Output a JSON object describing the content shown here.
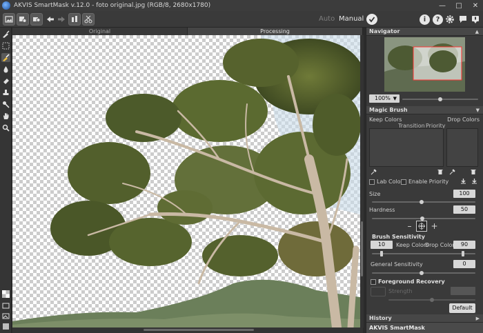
{
  "window": {
    "title": "AKVIS SmartMask v.12.0 - foto original.jpg (RGB/8, 2680x1780)"
  },
  "toolbar": {
    "mode_auto": "Auto",
    "mode_manual": "Manual"
  },
  "tabs": [
    {
      "label": "Original"
    },
    {
      "label": "Processing"
    }
  ],
  "navigator": {
    "title": "Navigator",
    "zoom": "100%"
  },
  "magic_brush": {
    "title": "Magic Brush",
    "keep_colors": "Keep Colors",
    "drop_colors": "Drop Colors",
    "transition": "Transition",
    "priority": "Priority",
    "lab_colors": "Lab Colors",
    "enable_priority": "Enable Priority",
    "size_label": "Size",
    "size_value": "100",
    "hardness_label": "Hardness",
    "hardness_value": "50",
    "brush_sensitivity": "Brush Sensitivity",
    "keep_value": "10",
    "keep_label": "Keep Colors",
    "drop_label": "Drop Colors",
    "drop_value": "90",
    "general_sensitivity": "General Sensitivity",
    "general_value": "0",
    "foreground_recovery": "Foreground Recovery",
    "strength_label": "Strength",
    "default_button": "Default"
  },
  "history": {
    "title": "History",
    "footer": "AKVIS SmartMask"
  },
  "colors": {
    "accent": "#e9e9e9",
    "panel": "#3a3a3a"
  }
}
